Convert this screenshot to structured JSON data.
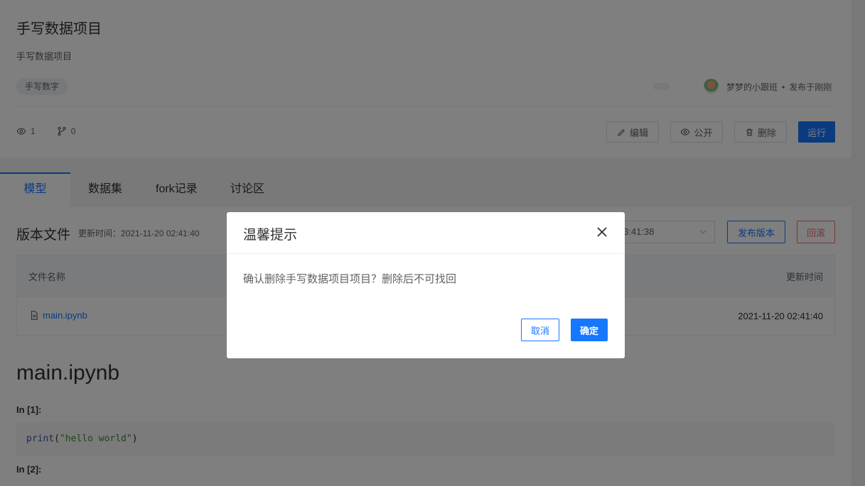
{
  "project": {
    "title": "手写数据项目",
    "description": "手写数据项目",
    "tag": "手写数字",
    "author": "梦梦的小跟班",
    "published": "发布于刚刚",
    "views": "1",
    "forks": "0"
  },
  "actions": {
    "edit": "编辑",
    "public": "公开",
    "delete": "删除",
    "run": "运行"
  },
  "tabs": [
    {
      "label": "模型"
    },
    {
      "label": "数据集"
    },
    {
      "label": "fork记录"
    },
    {
      "label": "讨论区"
    }
  ],
  "files": {
    "section_title": "版本文件",
    "update_time": "更新时间：2021-11-20 02:41:40",
    "version_value": "3:41:38",
    "publish_version": "发布版本",
    "rollback": "回滚",
    "col_name": "文件名称",
    "col_time": "更新时间",
    "rows": [
      {
        "name": "main.ipynb",
        "time": "2021-11-20 02:41:40"
      }
    ]
  },
  "notebook": {
    "title": "main.ipynb",
    "cell1_label": "In [1]:",
    "cell1_fn": "print",
    "cell1_open": "(",
    "cell1_str": "\"hello world\"",
    "cell1_close": ")",
    "cell2_label": "In [2]:"
  },
  "dialog": {
    "title": "温馨提示",
    "message": "确认删除手写数据项目项目？删除后不可找回",
    "cancel": "取消",
    "confirm": "确定"
  },
  "colors": {
    "primary": "#1677ff",
    "danger": "#f56c6c",
    "overlay": "rgba(0,0,0,0.5)"
  }
}
